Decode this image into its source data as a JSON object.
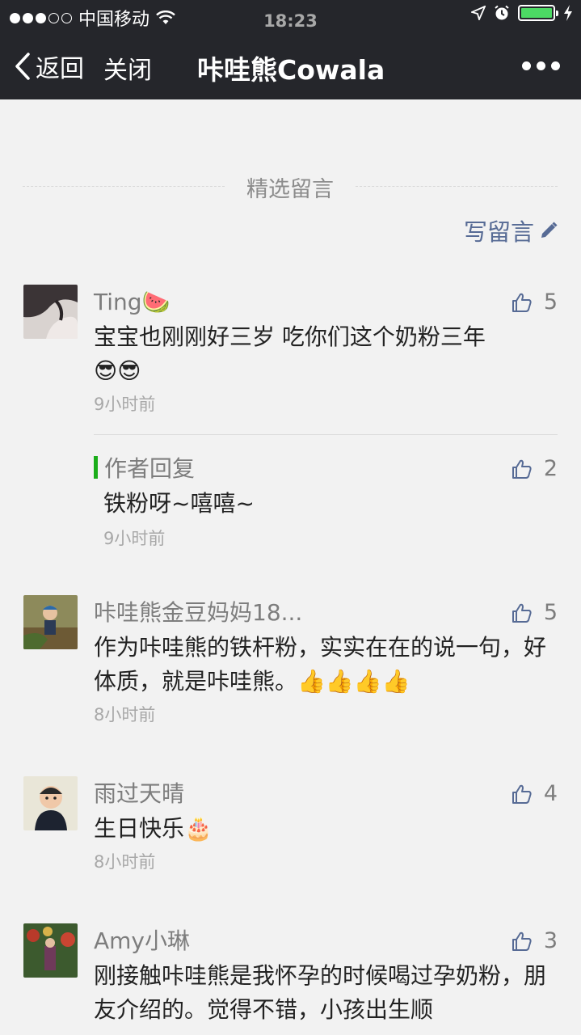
{
  "status_bar": {
    "carrier": "中国移动",
    "time": "18:23"
  },
  "nav": {
    "back_label": "返回",
    "close_label": "关闭",
    "title": "咔哇熊Cowala"
  },
  "section": {
    "title": "精选留言",
    "write_label": "写留言"
  },
  "comments": [
    {
      "nickname": "Ting🍉",
      "text": "宝宝也刚刚好三岁  吃你们这个奶粉三年",
      "emoji_text": "😎😎",
      "time": "9小时前",
      "likes": "5",
      "reply": {
        "label": "作者回复",
        "text": "铁粉呀~嘻嘻~",
        "time": "9小时前",
        "likes": "2"
      }
    },
    {
      "nickname": "咔哇熊金豆妈妈18...",
      "text": "作为咔哇熊的铁杆粉，实实在在的说一句，好体质，就是咔哇熊。👍👍👍👍",
      "time": "8小时前",
      "likes": "5"
    },
    {
      "nickname": "雨过天晴",
      "text": "生日快乐🎂",
      "time": "8小时前",
      "likes": "4"
    },
    {
      "nickname": "Amy小琳",
      "text": "刚接触咔哇熊是我怀孕的时候喝过孕奶粉，朋友介绍的。觉得不错，小孩出生顺",
      "likes": "3"
    }
  ]
}
